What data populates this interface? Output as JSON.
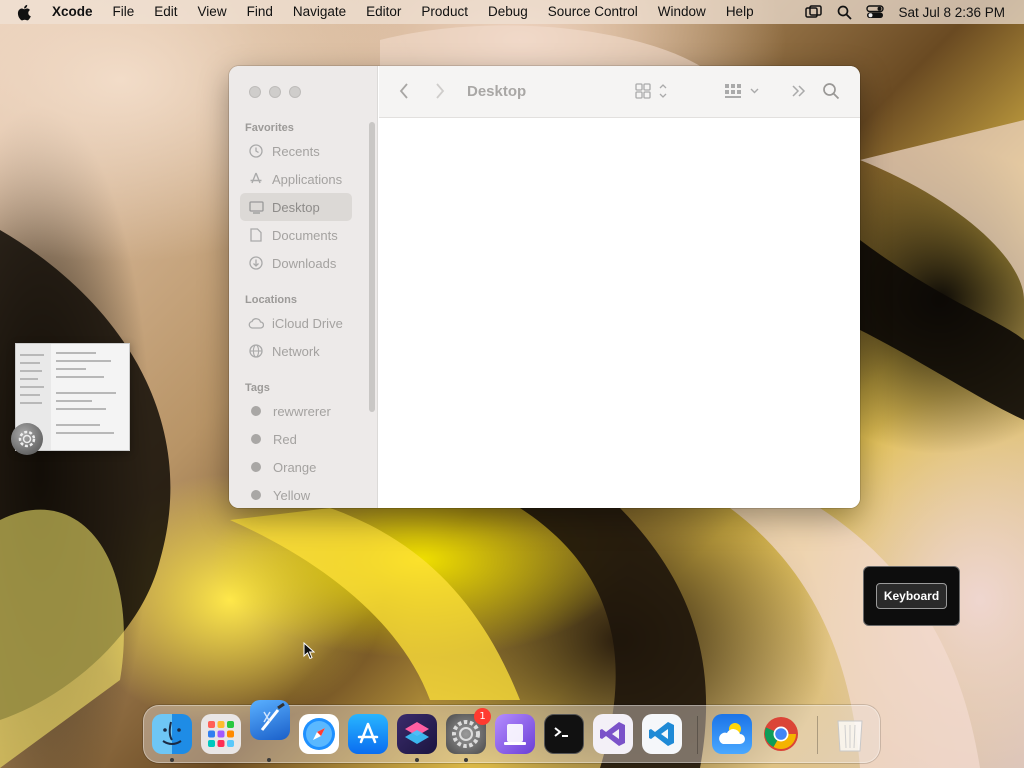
{
  "menubar": {
    "app_name": "Xcode",
    "items": [
      "File",
      "Edit",
      "View",
      "Find",
      "Navigate",
      "Editor",
      "Product",
      "Debug",
      "Source Control",
      "Window",
      "Help"
    ],
    "clock": "Sat Jul 8  2:36 PM"
  },
  "finder": {
    "title": "Desktop",
    "favorites_label": "Favorites",
    "favorites": [
      "Recents",
      "Applications",
      "Desktop",
      "Documents",
      "Downloads"
    ],
    "locations_label": "Locations",
    "locations": [
      "iCloud Drive",
      "Network"
    ],
    "tags_label": "Tags",
    "tags": [
      "rewwrerer",
      "Red",
      "Orange",
      "Yellow"
    ],
    "selected": "Desktop"
  },
  "hud": {
    "label": "Keyboard"
  },
  "dock": {
    "apps": [
      "Finder",
      "Launchpad",
      "Xcode",
      "Safari",
      "App Store",
      "Shortcuts",
      "System Settings",
      "Simulator",
      "Terminal",
      "Visual Studio",
      "Visual Studio Code",
      "Weather",
      "Google Chrome",
      "Trash"
    ],
    "system_settings_badge": "1"
  },
  "colors": {
    "accent": "#2f7ff0",
    "badge": "#ff3b30",
    "sidebar_text": "#a4a2a0"
  }
}
